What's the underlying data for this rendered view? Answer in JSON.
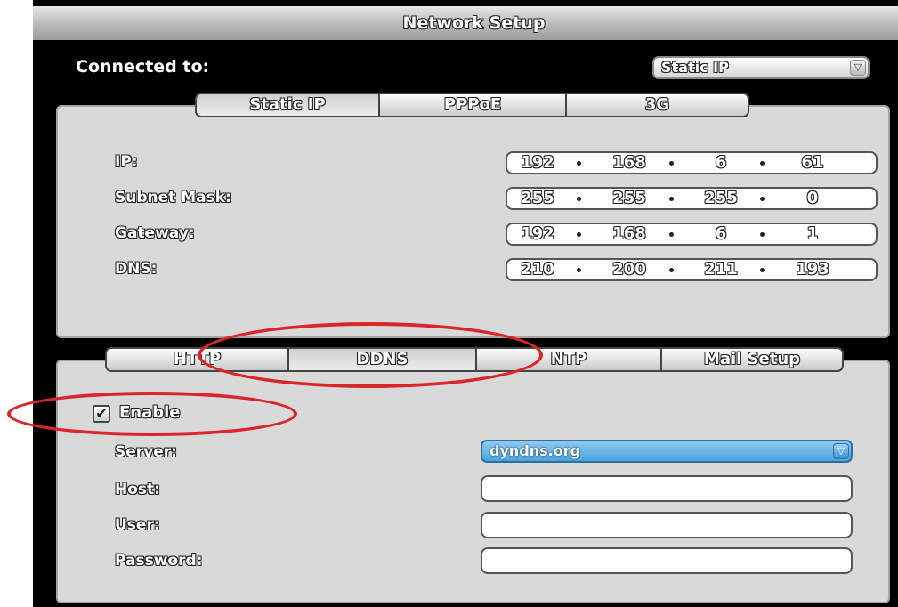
{
  "window": {
    "title": "Network Setup"
  },
  "connection": {
    "label": "Connected to:",
    "selected": "Static IP"
  },
  "top_tabs": [
    {
      "label": "Static IP",
      "active": true
    },
    {
      "label": "PPPoE",
      "active": false
    },
    {
      "label": "3G",
      "active": false
    }
  ],
  "ip_rows": [
    {
      "label": "IP:",
      "octets": [
        "192",
        "168",
        "6",
        "61"
      ]
    },
    {
      "label": "Subnet Mask:",
      "octets": [
        "255",
        "255",
        "255",
        "0"
      ]
    },
    {
      "label": "Gateway:",
      "octets": [
        "192",
        "168",
        "6",
        "1"
      ]
    },
    {
      "label": "DNS:",
      "octets": [
        "210",
        "200",
        "211",
        "193"
      ]
    }
  ],
  "bottom_tabs": [
    {
      "label": "HTTP",
      "active": false
    },
    {
      "label": "DDNS",
      "active": true
    },
    {
      "label": "NTP",
      "active": false
    },
    {
      "label": "Mail Setup",
      "active": false
    }
  ],
  "ddns": {
    "enable_label": "Enable",
    "enabled": true,
    "server_label": "Server:",
    "server_value": "dyndns.org",
    "host_label": "Host:",
    "host_value": "",
    "user_label": "User:",
    "user_value": "",
    "password_label": "Password:",
    "password_value": ""
  },
  "icons": {
    "dropdown": "chevron-down-icon",
    "check": "checkmark-icon"
  },
  "colors": {
    "highlight_ellipse": "#d9262b",
    "selected_dropdown": "#4aa5de",
    "panel": "#d9d9d9"
  }
}
